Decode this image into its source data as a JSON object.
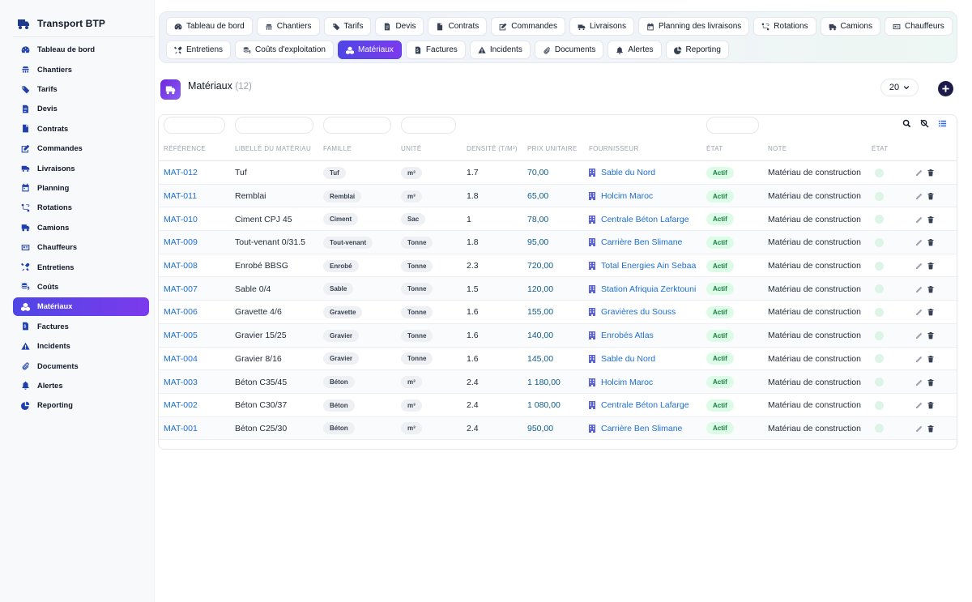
{
  "app": {
    "title": "Transport BTP"
  },
  "sidebar": {
    "items": [
      {
        "label": "Tableau de bord",
        "icon": "dashboard-icon"
      },
      {
        "label": "Chantiers",
        "icon": "site-icon"
      },
      {
        "label": "Tarifs",
        "icon": "tag-icon"
      },
      {
        "label": "Devis",
        "icon": "file-icon"
      },
      {
        "label": "Contrats",
        "icon": "document-icon"
      },
      {
        "label": "Commandes",
        "icon": "edit-icon"
      },
      {
        "label": "Livraisons",
        "icon": "delivery-icon"
      },
      {
        "label": "Planning",
        "icon": "calendar-icon"
      },
      {
        "label": "Rotations",
        "icon": "route-icon"
      },
      {
        "label": "Camions",
        "icon": "truck-icon"
      },
      {
        "label": "Chauffeurs",
        "icon": "id-card-icon"
      },
      {
        "label": "Entretiens",
        "icon": "tools-icon"
      },
      {
        "label": "Coûts",
        "icon": "coins-icon"
      },
      {
        "label": "Matériaux",
        "icon": "cubes-icon",
        "active": true
      },
      {
        "label": "Factures",
        "icon": "invoice-icon"
      },
      {
        "label": "Incidents",
        "icon": "warning-icon"
      },
      {
        "label": "Documents",
        "icon": "paperclip-icon"
      },
      {
        "label": "Alertes",
        "icon": "bell-icon"
      },
      {
        "label": "Reporting",
        "icon": "pie-chart-icon"
      }
    ]
  },
  "tabs": {
    "row1": [
      {
        "label": "Tableau de bord",
        "icon": "dashboard-icon"
      },
      {
        "label": "Chantiers",
        "icon": "site-icon"
      },
      {
        "label": "Tarifs",
        "icon": "tag-icon"
      },
      {
        "label": "Devis",
        "icon": "file-icon"
      },
      {
        "label": "Contrats",
        "icon": "document-icon"
      },
      {
        "label": "Commandes",
        "icon": "edit-icon"
      },
      {
        "label": "Livraisons",
        "icon": "delivery-icon"
      },
      {
        "label": "Planning des livraisons",
        "icon": "calendar-icon"
      },
      {
        "label": "Rotations",
        "icon": "route-icon"
      },
      {
        "label": "Camions",
        "icon": "truck-icon"
      },
      {
        "label": "Chauffeurs",
        "icon": "id-card-icon"
      }
    ],
    "row2": [
      {
        "label": "Entretiens",
        "icon": "tools-icon"
      },
      {
        "label": "Coûts d'exploitation",
        "icon": "coins-icon"
      },
      {
        "label": "Matériaux",
        "icon": "cubes-icon",
        "active": true
      },
      {
        "label": "Factures",
        "icon": "invoice-icon"
      },
      {
        "label": "Incidents",
        "icon": "warning-icon"
      },
      {
        "label": "Documents",
        "icon": "paperclip-icon"
      },
      {
        "label": "Alertes",
        "icon": "bell-icon"
      },
      {
        "label": "Reporting",
        "icon": "pie-chart-icon"
      }
    ]
  },
  "page": {
    "title": "Matériaux",
    "count": "(12)",
    "page_size": "20"
  },
  "table": {
    "headers": {
      "ref": "Référence",
      "libelle": "Libellé du matériau",
      "famille": "Famille",
      "unite": "Unité",
      "densite": "Densité (t/m³)",
      "prix": "Prix unitaire",
      "fournisseur": "Fournisseur",
      "etat": "État",
      "note": "Note",
      "etat2": "État"
    },
    "rows": [
      {
        "ref": "MAT-012",
        "libelle": "Tuf",
        "famille": "Tuf",
        "unite": "m³",
        "densite": "1.7",
        "prix": "70,00",
        "fournisseur": "Sable du Nord",
        "etat": "Actif",
        "note": "Matériau de construction"
      },
      {
        "ref": "MAT-011",
        "libelle": "Remblai",
        "famille": "Remblai",
        "unite": "m³",
        "densite": "1.8",
        "prix": "65,00",
        "fournisseur": "Holcim Maroc",
        "etat": "Actif",
        "note": "Matériau de construction"
      },
      {
        "ref": "MAT-010",
        "libelle": "Ciment CPJ 45",
        "famille": "Ciment",
        "unite": "Sac",
        "densite": "1",
        "prix": "78,00",
        "fournisseur": "Centrale Béton Lafarge",
        "etat": "Actif",
        "note": "Matériau de construction"
      },
      {
        "ref": "MAT-009",
        "libelle": "Tout-venant 0/31.5",
        "famille": "Tout-venant",
        "unite": "Tonne",
        "densite": "1.8",
        "prix": "95,00",
        "fournisseur": "Carrière Ben Slimane",
        "etat": "Actif",
        "note": "Matériau de construction"
      },
      {
        "ref": "MAT-008",
        "libelle": "Enrobé BBSG",
        "famille": "Enrobé",
        "unite": "Tonne",
        "densite": "2.3",
        "prix": "720,00",
        "fournisseur": "Total Energies Ain Sebaa",
        "etat": "Actif",
        "note": "Matériau de construction"
      },
      {
        "ref": "MAT-007",
        "libelle": "Sable 0/4",
        "famille": "Sable",
        "unite": "Tonne",
        "densite": "1.5",
        "prix": "120,00",
        "fournisseur": "Station Afriquia Zerktouni",
        "etat": "Actif",
        "note": "Matériau de construction"
      },
      {
        "ref": "MAT-006",
        "libelle": "Gravette 4/6",
        "famille": "Gravette",
        "unite": "Tonne",
        "densite": "1.6",
        "prix": "155,00",
        "fournisseur": "Gravières du Souss",
        "etat": "Actif",
        "note": "Matériau de construction"
      },
      {
        "ref": "MAT-005",
        "libelle": "Gravier 15/25",
        "famille": "Gravier",
        "unite": "Tonne",
        "densite": "1.6",
        "prix": "140,00",
        "fournisseur": "Enrobés Atlas",
        "etat": "Actif",
        "note": "Matériau de construction"
      },
      {
        "ref": "MAT-004",
        "libelle": "Gravier 8/16",
        "famille": "Gravier",
        "unite": "Tonne",
        "densite": "1.6",
        "prix": "145,00",
        "fournisseur": "Sable du Nord",
        "etat": "Actif",
        "note": "Matériau de construction"
      },
      {
        "ref": "MAT-003",
        "libelle": "Béton C35/45",
        "famille": "Béton",
        "unite": "m³",
        "densite": "2.4",
        "prix": "1 180,00",
        "fournisseur": "Holcim Maroc",
        "etat": "Actif",
        "note": "Matériau de construction"
      },
      {
        "ref": "MAT-002",
        "libelle": "Béton C30/37",
        "famille": "Béton",
        "unite": "m³",
        "densite": "2.4",
        "prix": "1 080,00",
        "fournisseur": "Centrale Béton Lafarge",
        "etat": "Actif",
        "note": "Matériau de construction"
      },
      {
        "ref": "MAT-001",
        "libelle": "Béton C25/30",
        "famille": "Béton",
        "unite": "m³",
        "densite": "2.4",
        "prix": "950,00",
        "fournisseur": "Carrière Ben Slimane",
        "etat": "Actif",
        "note": "Matériau de construction"
      }
    ]
  },
  "colors": {
    "accent": "#4f46e5",
    "accent_end": "#7c3aed",
    "link": "#1d6fd1",
    "status_bg": "#dcfce7",
    "status_text": "#15803d"
  }
}
